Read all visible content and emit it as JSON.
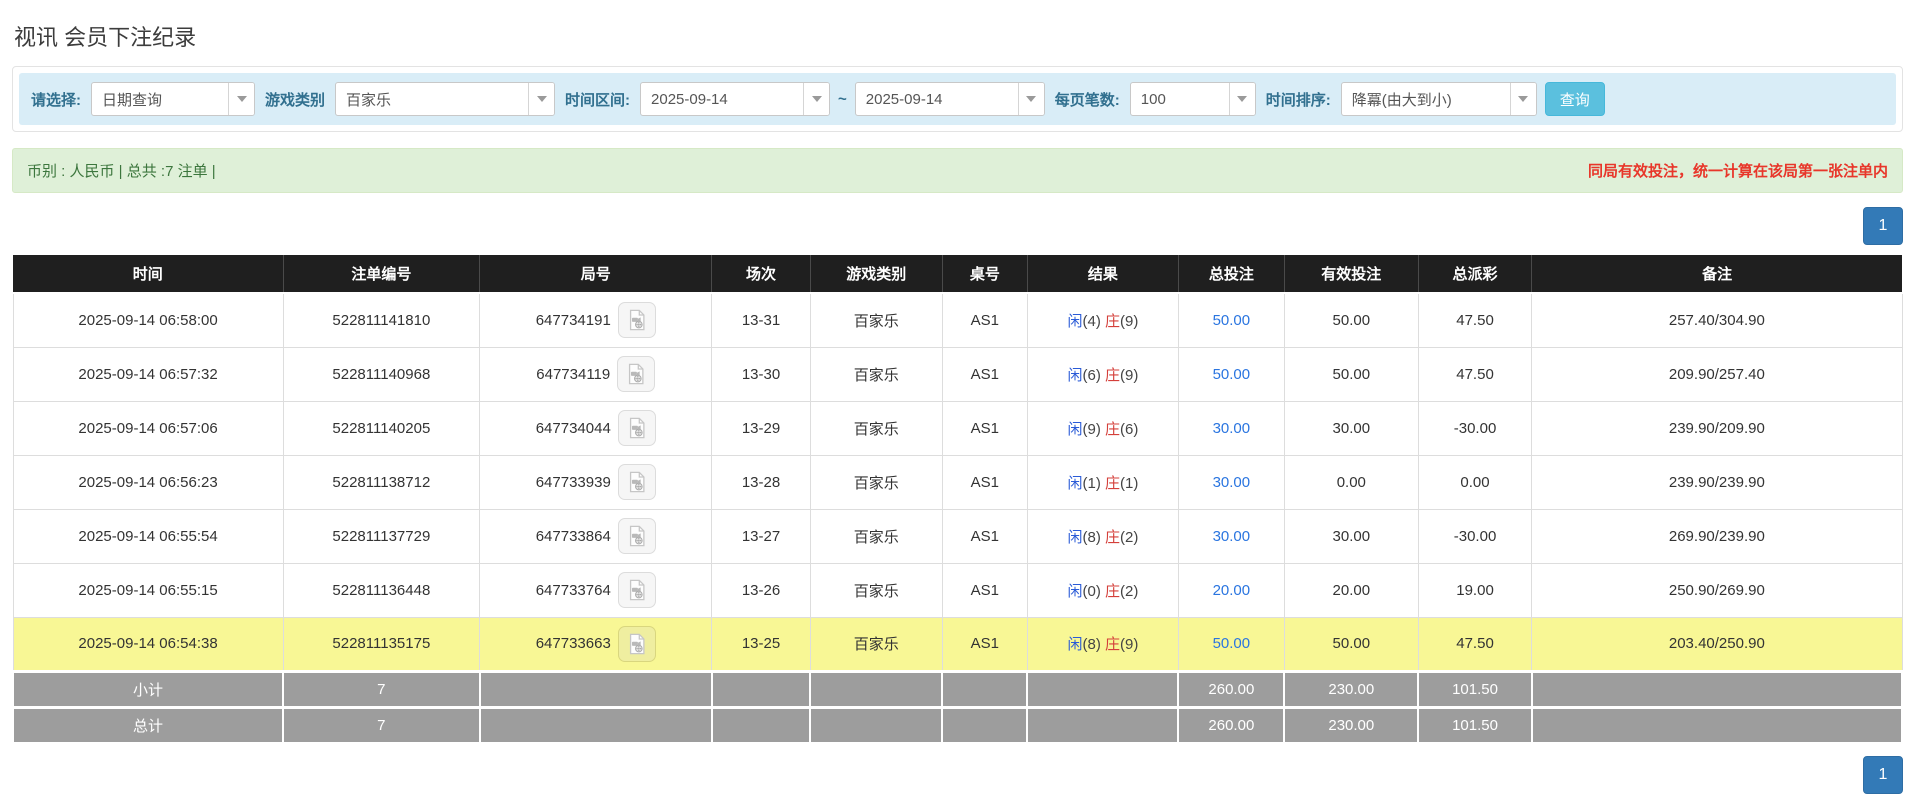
{
  "page": {
    "title": "视讯 会员下注纪录"
  },
  "filters": {
    "select_label": "请选择:",
    "select_value": "日期查询",
    "game_label": "游戏类别",
    "game_value": "百家乐",
    "range_label": "时间区间:",
    "date_from": "2025-09-14",
    "range_separator": "~",
    "date_to": "2025-09-14",
    "page_size_label": "每页笔数:",
    "page_size_value": "100",
    "sort_label": "时间排序:",
    "sort_value": "降冪(由大到小)",
    "query_button": "查询"
  },
  "summary": {
    "left": "币别 : 人民币 | 总共 :7 注单 |",
    "right_notice": "同局有效投注，统一计算在该局第一张注单内"
  },
  "pagination": {
    "page": "1"
  },
  "colors": {
    "filter_bg": "#d9edf7",
    "query_button": "#5bc0de",
    "summary_bg": "#dff0d8",
    "summary_text": "#3c763d",
    "notice_red": "#e8362a",
    "pagination_blue": "#337ab7",
    "header_bg": "#1f1f1f",
    "footer_bg": "#9d9d9d",
    "highlight_row": "#f8f795",
    "link_blue": "#2a75e0",
    "negative_red": "#e23333",
    "player_blue": "#2a5bd7",
    "banker_red": "#d43f3a"
  },
  "table": {
    "headers": [
      "时间",
      "注单编号",
      "局号",
      "场次",
      "游戏类别",
      "桌号",
      "结果",
      "总投注",
      "有效投注",
      "总派彩",
      "备注"
    ],
    "result_labels": {
      "player": "闲",
      "banker": "庄"
    },
    "video_icon": "video-file-icon",
    "rows": [
      {
        "time": "2025-09-14 06:58:00",
        "bet_id": "522811141810",
        "round_id": "647734191",
        "session": "13-31",
        "game": "百家乐",
        "table_no": "AS1",
        "player": "4",
        "banker": "9",
        "total_bet": "50.00",
        "valid_bet": "50.00",
        "payout": "47.50",
        "remark": "257.40/304.90",
        "highlight": false
      },
      {
        "time": "2025-09-14 06:57:32",
        "bet_id": "522811140968",
        "round_id": "647734119",
        "session": "13-30",
        "game": "百家乐",
        "table_no": "AS1",
        "player": "6",
        "banker": "9",
        "total_bet": "50.00",
        "valid_bet": "50.00",
        "payout": "47.50",
        "remark": "209.90/257.40",
        "highlight": false
      },
      {
        "time": "2025-09-14 06:57:06",
        "bet_id": "522811140205",
        "round_id": "647734044",
        "session": "13-29",
        "game": "百家乐",
        "table_no": "AS1",
        "player": "9",
        "banker": "6",
        "total_bet": "30.00",
        "valid_bet": "30.00",
        "payout": "-30.00",
        "remark": "239.90/209.90",
        "highlight": false
      },
      {
        "time": "2025-09-14 06:56:23",
        "bet_id": "522811138712",
        "round_id": "647733939",
        "session": "13-28",
        "game": "百家乐",
        "table_no": "AS1",
        "player": "1",
        "banker": "1",
        "total_bet": "30.00",
        "valid_bet": "0.00",
        "payout": "0.00",
        "remark": "239.90/239.90",
        "highlight": false
      },
      {
        "time": "2025-09-14 06:55:54",
        "bet_id": "522811137729",
        "round_id": "647733864",
        "session": "13-27",
        "game": "百家乐",
        "table_no": "AS1",
        "player": "8",
        "banker": "2",
        "total_bet": "30.00",
        "valid_bet": "30.00",
        "payout": "-30.00",
        "remark": "269.90/239.90",
        "highlight": false
      },
      {
        "time": "2025-09-14 06:55:15",
        "bet_id": "522811136448",
        "round_id": "647733764",
        "session": "13-26",
        "game": "百家乐",
        "table_no": "AS1",
        "player": "0",
        "banker": "2",
        "total_bet": "20.00",
        "valid_bet": "20.00",
        "payout": "19.00",
        "remark": "250.90/269.90",
        "highlight": false
      },
      {
        "time": "2025-09-14 06:54:38",
        "bet_id": "522811135175",
        "round_id": "647733663",
        "session": "13-25",
        "game": "百家乐",
        "table_no": "AS1",
        "player": "8",
        "banker": "9",
        "total_bet": "50.00",
        "valid_bet": "50.00",
        "payout": "47.50",
        "remark": "203.40/250.90",
        "highlight": true
      }
    ],
    "footer": [
      {
        "label": "小计",
        "count": "7",
        "total_bet": "260.00",
        "valid_bet": "230.00",
        "payout": "101.50"
      },
      {
        "label": "总计",
        "count": "7",
        "total_bet": "260.00",
        "valid_bet": "230.00",
        "payout": "101.50"
      }
    ]
  }
}
